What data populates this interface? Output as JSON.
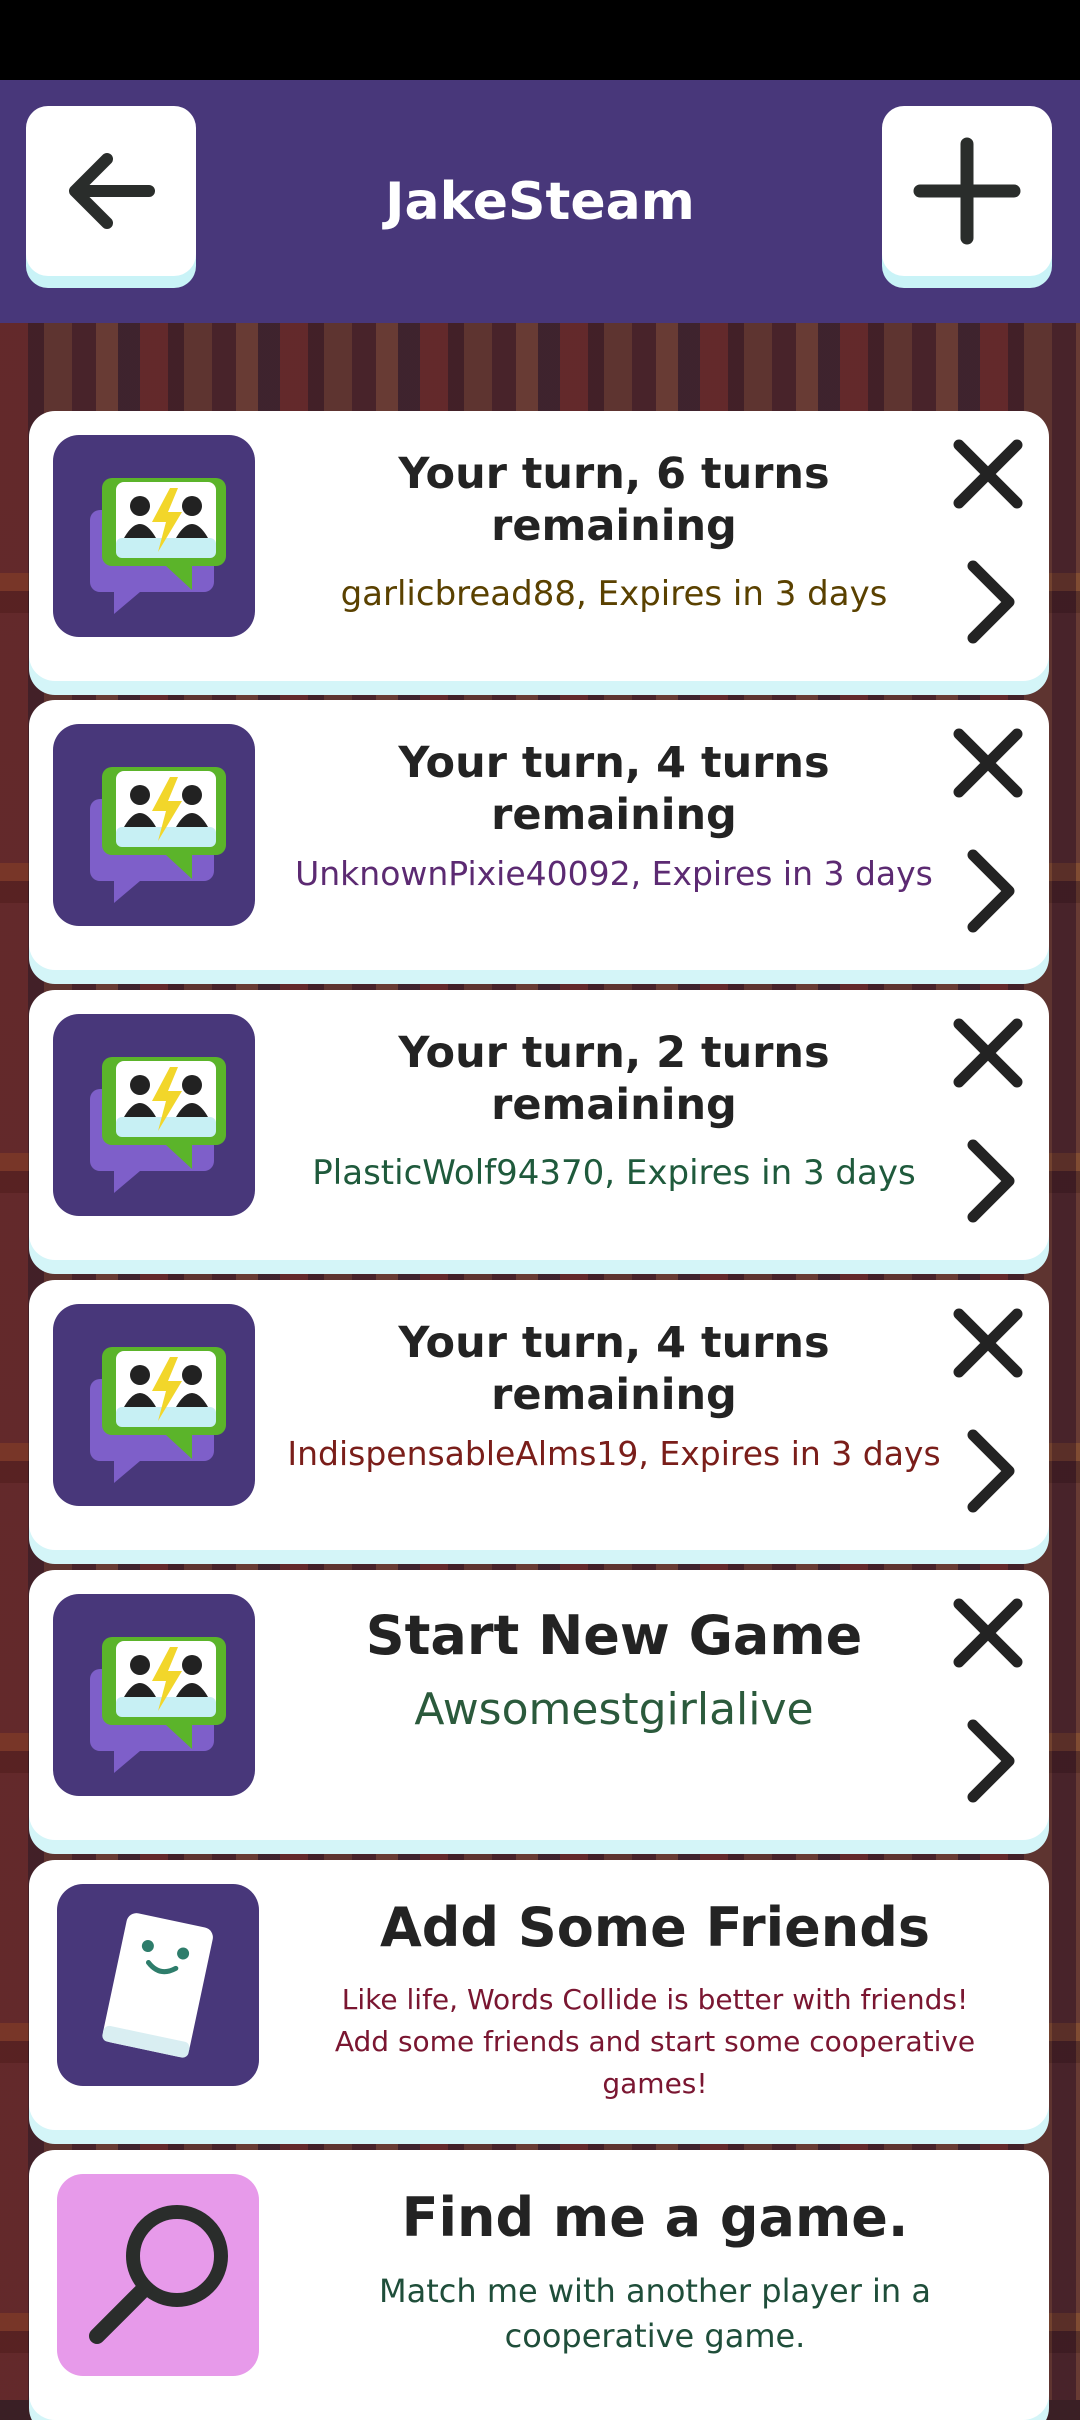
{
  "header": {
    "title": "JakeSteam",
    "back_icon": "arrow-left-icon",
    "add_icon": "plus-icon"
  },
  "games": [
    {
      "headline": "Your turn, 6 turns remaining",
      "subtitle": "garlicbread88, Expires in 3 days",
      "color": "#5a4100"
    },
    {
      "headline": "Your turn, 4 turns remaining",
      "subtitle": "UnknownPixie40092, Expires in 3 days",
      "color": "#5c2a72"
    },
    {
      "headline": "Your turn, 2 turns remaining",
      "subtitle": "PlasticWolf94370, Expires in 3 days",
      "color": "#1f5a3c"
    },
    {
      "headline": "Your turn, 4 turns remaining",
      "subtitle": "IndispensableAlms19, Expires in 3 days",
      "color": "#7a1e1a"
    }
  ],
  "new_game": {
    "title": "Start New Game",
    "opponent": "Awsomestgirlalive",
    "color": "#2b5a3c"
  },
  "friends": {
    "title": "Add Some Friends",
    "line1": "Like life, Words Collide is better with friends!",
    "line2": "Add some friends and start some cooperative games!",
    "color": "#7a1631"
  },
  "find": {
    "title": "Find me a game.",
    "text": "Match me with another player in a cooperative game.",
    "color": "#1f4e3a"
  }
}
